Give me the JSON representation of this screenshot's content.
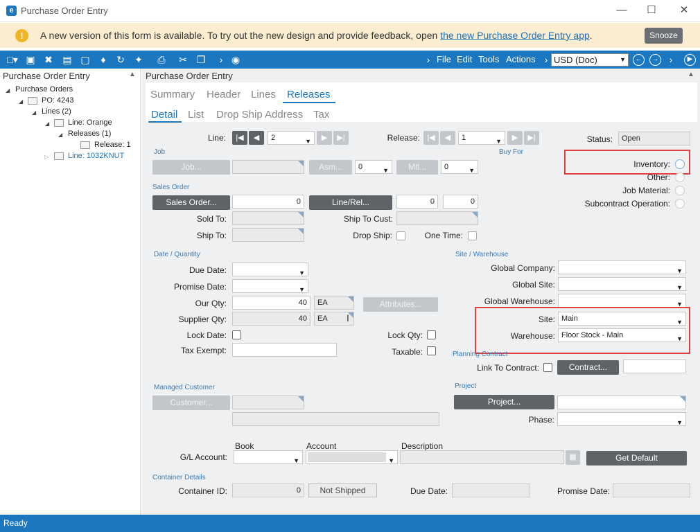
{
  "window": {
    "title": "Purchase Order Entry",
    "logo": "e"
  },
  "banner": {
    "message": "A new version of this form is available. To try out the new design and provide feedback, open ",
    "link": "the new Purchase Order Entry app",
    "tail": ".",
    "snooze": "Snooze",
    "warn_icon": "!"
  },
  "toolbar": {
    "menus": [
      "File",
      "Edit",
      "Tools",
      "Actions"
    ],
    "currency": "USD (Doc)"
  },
  "leftpane": {
    "title": "Purchase Order Entry",
    "tree": [
      "Purchase Orders",
      "PO: 4243",
      "Lines (2)",
      "Line: Orange",
      "Releases (1)",
      "Release: 1",
      "Line: 1032KNUT"
    ]
  },
  "rightpane": {
    "title": "Purchase Order Entry"
  },
  "tabs": {
    "top": [
      "Summary",
      "Header",
      "Lines",
      "Releases"
    ],
    "sub": [
      "Detail",
      "List",
      "Drop Ship Address",
      "Tax"
    ]
  },
  "form": {
    "line_label": "Line:",
    "line_value": "2",
    "release_label": "Release:",
    "release_value": "1",
    "status_label": "Status:",
    "status_value": "Open",
    "job_section": "Job",
    "job_btn": "Job...",
    "asm_btn": "Asm...",
    "asm_value": "0",
    "mtl_btn": "Mtl...",
    "mtl_value": "0",
    "buyfor_section": "Buy For",
    "inventory": "Inventory:",
    "other": "Other:",
    "job_material": "Job Material:",
    "subcontract": "Subcontract Operation:",
    "sales_section": "Sales Order",
    "sales_btn": "Sales Order...",
    "sales_value": "0",
    "linerel_btn": "Line/Rel...",
    "linerel_v1": "0",
    "linerel_v2": "0",
    "sold_to": "Sold To:",
    "ship_to_cust": "Ship To Cust:",
    "ship_to": "Ship To:",
    "drop_ship": "Drop Ship:",
    "one_time": "One Time:",
    "date_section": "Date / Quantity",
    "due_date": "Due Date:",
    "promise_date": "Promise Date:",
    "our_qty": "Our Qty:",
    "our_qty_value": "40",
    "our_uom": "EA",
    "supplier_qty": "Supplier Qty:",
    "supplier_qty_value": "40",
    "supplier_uom": "EA",
    "attributes_btn": "Attributes...",
    "lock_date": "Lock Date:",
    "lock_qty": "Lock Qty:",
    "tax_exempt": "Tax Exempt:",
    "taxable": "Taxable:",
    "site_section": "Site / Warehouse",
    "global_company": "Global Company:",
    "global_site": "Global Site:",
    "global_warehouse": "Global Warehouse:",
    "site": "Site:",
    "site_value": "Main",
    "warehouse": "Warehouse:",
    "warehouse_value": "Floor Stock - Main",
    "planning_section": "Planning Contract",
    "link_contract": "Link To Contract:",
    "contract_btn": "Contract...",
    "managed_section": "Managed Customer",
    "customer_btn": "Customer...",
    "project_section": "Project",
    "project_btn": "Project...",
    "phase": "Phase:",
    "gl_label": "G/L Account:",
    "book_hdr": "Book",
    "account_hdr": "Account",
    "desc_hdr": "Description",
    "get_default": "Get Default",
    "container_section": "Container Details",
    "container_id": "Container ID:",
    "container_value": "0",
    "not_shipped": "Not Shipped",
    "c_due_date": "Due Date:",
    "c_promise_date": "Promise Date:"
  },
  "status": "Ready"
}
